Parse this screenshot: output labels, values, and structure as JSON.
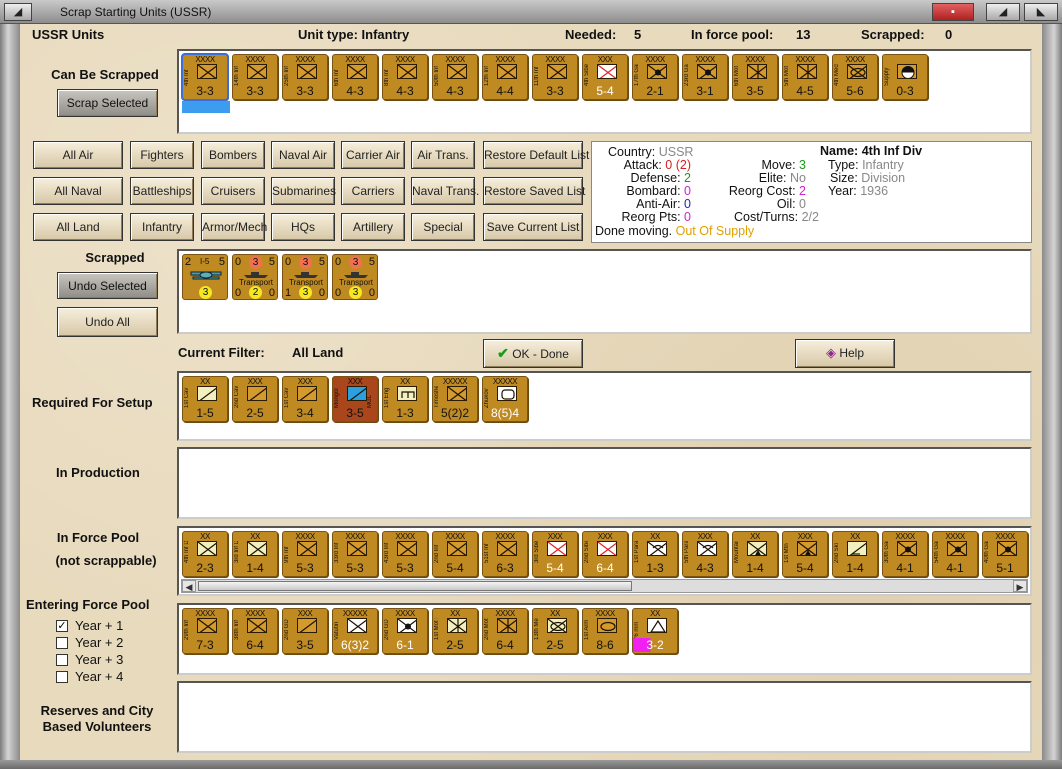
{
  "window": {
    "title": "Scrap Starting Units (USSR)",
    "icon": "window-menu-icon"
  },
  "header": {
    "units_label": "USSR Units",
    "unit_type": "Unit type: Infantry",
    "needed_label": "Needed:",
    "needed": "5",
    "pool_label": "In force pool:",
    "pool": "13",
    "scrapped_label": "Scrapped:",
    "scrapped": "0"
  },
  "labels": {
    "can_be_scrapped": "Can Be Scrapped",
    "scrapped": "Scrapped",
    "current_filter_label": "Current Filter:",
    "current_filter": "All Land",
    "required": "Required For Setup",
    "in_production": "In Production",
    "in_force_pool_1": "In Force Pool",
    "in_force_pool_2": "(not scrappable)",
    "entering": "Entering Force Pool",
    "reserves_1": "Reserves and City",
    "reserves_2": "Based Volunteers"
  },
  "buttons": {
    "scrap_selected": "Scrap Selected",
    "undo_selected": "Undo Selected",
    "undo_all": "Undo All",
    "ok": "OK - Done",
    "help": "Help"
  },
  "filters": [
    [
      "All Air",
      "Fighters",
      "Bombers",
      "Naval Air",
      "Carrier Air",
      "Air Trans.",
      "Restore Default List"
    ],
    [
      "All Naval",
      "Battleships",
      "Cruisers",
      "Submarines",
      "Carriers",
      "Naval Trans.",
      "Restore Saved List"
    ],
    [
      "All Land",
      "Infantry",
      "Armor/Mech",
      "HQs",
      "Artillery",
      "Special",
      "Save Current List"
    ]
  ],
  "info": {
    "country_label": "Country:",
    "country": "USSR",
    "attack_label": "Attack:",
    "attack": "0 (2)",
    "defense_label": "Defense:",
    "defense": "2",
    "bombard_label": "Bombard:",
    "bombard": "0",
    "antiair_label": "Anti-Air:",
    "antiair": "0",
    "reorgpts_label": "Reorg Pts:",
    "reorgpts": "0",
    "done_moving": "Done moving.",
    "supply": "Out Of Supply",
    "move_label": "Move:",
    "move": "3",
    "elite_label": "Elite:",
    "elite": "No",
    "reorgcost_label": "Reorg Cost:",
    "reorgcost": "2",
    "oil_label": "Oil:",
    "oil": "0",
    "costturns_label": "Cost/Turns:",
    "costturns": "2/2",
    "name_label": "Name:",
    "name": "4th Inf Div",
    "type_label": "Type:",
    "type": "Infantry",
    "size_label": "Size:",
    "size": "Division",
    "year_label": "Year:",
    "year": "1936"
  },
  "can_scrap": [
    {
      "size": "XXXX",
      "name": "4th Inf",
      "stats": "3-3",
      "sel": true
    },
    {
      "size": "XXXX",
      "name": "14th Inf",
      "stats": "3-3"
    },
    {
      "size": "XXXX",
      "name": "25th Inf",
      "stats": "3-3"
    },
    {
      "size": "XXXX",
      "name": "6th Inf",
      "stats": "4-3"
    },
    {
      "size": "XXXX",
      "name": "8th Inf",
      "stats": "4-3"
    },
    {
      "size": "XXXX",
      "name": "50th Inf",
      "stats": "4-3"
    },
    {
      "size": "XXXX",
      "name": "12th Inf",
      "stats": "4-4"
    },
    {
      "size": "XXXX",
      "name": "11th Inf",
      "stats": "3-3"
    },
    {
      "size": "XXX",
      "name": "4th Siberian",
      "stats": "5-4",
      "style": "red"
    },
    {
      "size": "XXXX",
      "name": "17th Garr",
      "stats": "2-1",
      "sym": "garr"
    },
    {
      "size": "XXXX",
      "name": "23rd Garr",
      "stats": "3-1",
      "sym": "garr"
    },
    {
      "size": "XXXX",
      "name": "6th Mot",
      "stats": "3-5",
      "sym": "mot"
    },
    {
      "size": "XXXX",
      "name": "5th Mot",
      "stats": "4-5",
      "sym": "mot"
    },
    {
      "size": "XXXX",
      "name": "4th Mech",
      "stats": "5-6",
      "sym": "mech"
    },
    {
      "size": "",
      "name": "Supply",
      "stats": "0-3",
      "sym": "supply"
    }
  ],
  "scrapped_units": [
    {
      "kind": "air",
      "tl": "2",
      "name": "I-5",
      "tr": "5",
      "bl": "",
      "circ": "3"
    },
    {
      "kind": "tr",
      "tl": "0",
      "top": "3",
      "tr": "5",
      "name": "Transport",
      "bl": "0",
      "circ": "2",
      "br": "0"
    },
    {
      "kind": "tr",
      "tl": "0",
      "top": "3",
      "tr": "5",
      "name": "Transport",
      "bl": "1",
      "circ": "3",
      "br": "0"
    },
    {
      "kind": "tr",
      "tl": "0",
      "top": "3",
      "tr": "5",
      "name": "Transport",
      "bl": "0",
      "circ": "3",
      "br": "0"
    }
  ],
  "required": [
    {
      "size": "XX",
      "name": "1st Cav Div",
      "stats": "1-5",
      "sym": "cav",
      "style": "lt"
    },
    {
      "size": "XXX",
      "name": "2nd Cav",
      "stats": "2-5",
      "sym": "cav"
    },
    {
      "size": "XXX",
      "name": "1st Cav",
      "stats": "3-4",
      "sym": "cav"
    },
    {
      "size": "XXX",
      "name": "Mongol",
      "stats": "3-5",
      "sym": "cav",
      "style": "blue",
      "side": "MGL"
    },
    {
      "size": "XX",
      "name": "1st Eng",
      "stats": "1-3",
      "sym": "eng",
      "style": "lt"
    },
    {
      "size": "XXXXX",
      "name": "Timoshenko",
      "stats": "5(2)2",
      "sym": "hq"
    },
    {
      "size": "XXXXX",
      "name": "Zhukov",
      "stats": "8(5)4",
      "sym": "hqw",
      "style": "wh",
      "wtxt": true
    }
  ],
  "force_pool": [
    {
      "size": "XX",
      "name": "4th Inf Div",
      "stats": "2-3",
      "style": "lt"
    },
    {
      "size": "XX",
      "name": "3rd Inf Div",
      "stats": "1-4",
      "style": "lt"
    },
    {
      "size": "XXXX",
      "name": "9th Inf",
      "stats": "5-3"
    },
    {
      "size": "XXXX",
      "name": "33rd Inf",
      "stats": "5-3"
    },
    {
      "size": "XXXX",
      "name": "43rd Inf",
      "stats": "5-3"
    },
    {
      "size": "XXXX",
      "name": "2nd Inf",
      "stats": "5-4"
    },
    {
      "size": "XXXX",
      "name": "51st Inf",
      "stats": "6-3"
    },
    {
      "size": "XXX",
      "name": "3rd Siberian",
      "stats": "5-4",
      "style": "red"
    },
    {
      "size": "XXX",
      "name": "2nd Siberian",
      "stats": "6-4",
      "style": "red"
    },
    {
      "size": "XX",
      "name": "1st Para Div",
      "stats": "1-3",
      "sym": "para",
      "style": "wh"
    },
    {
      "size": "XXX",
      "name": "5th Para",
      "stats": "4-3",
      "sym": "para",
      "style": "wh"
    },
    {
      "size": "XX",
      "name": "Mountain D.",
      "stats": "1-4",
      "sym": "mtn",
      "style": "lt"
    },
    {
      "size": "XXX",
      "name": "1st Mtn",
      "stats": "5-4",
      "sym": "mtn"
    },
    {
      "size": "XX",
      "name": "2nd Ski Div",
      "stats": "1-4",
      "sym": "ski",
      "style": "lt"
    },
    {
      "size": "XXXX",
      "name": "30th Garr",
      "stats": "4-1",
      "sym": "garr"
    },
    {
      "size": "XXXX",
      "name": "54th Garr",
      "stats": "4-1",
      "sym": "garr"
    },
    {
      "size": "XXXX",
      "name": "40th Garr",
      "stats": "5-1",
      "sym": "garr"
    }
  ],
  "entering": [
    {
      "size": "XXXX",
      "name": "29th Inf",
      "stats": "7-3"
    },
    {
      "size": "XXXX",
      "name": "38th Inf",
      "stats": "6-4"
    },
    {
      "size": "XXX",
      "name": "2nd GD Cav",
      "stats": "3-5",
      "sym": "cav"
    },
    {
      "size": "XXXXX",
      "name": "Vatutin",
      "stats": "6(3)2",
      "sym": "hq",
      "style": "wh",
      "wtxt": true
    },
    {
      "size": "XXXX",
      "name": "2nd GD Garr",
      "stats": "6-1",
      "sym": "garr",
      "style": "wh",
      "wtxt": true
    },
    {
      "size": "XX",
      "name": "1st Mot Div",
      "stats": "2-5",
      "sym": "mot",
      "style": "lt"
    },
    {
      "size": "XXXX",
      "name": "2nd Mot",
      "stats": "6-4",
      "sym": "mot"
    },
    {
      "size": "XX",
      "name": "13th Mech",
      "stats": "2-5",
      "sym": "mech",
      "style": "lt"
    },
    {
      "size": "XXXX",
      "name": "1st Arm",
      "stats": "8-6",
      "sym": "arm"
    },
    {
      "size": "XX",
      "name": "76 mm",
      "stats": "3-2",
      "sym": "art",
      "style": "wh",
      "pink": true
    }
  ],
  "years": [
    {
      "label": "Year + 1",
      "checked": "✓"
    },
    {
      "label": "Year + 2",
      "checked": ""
    },
    {
      "label": "Year + 3",
      "checked": ""
    },
    {
      "label": "Year + 4",
      "checked": ""
    }
  ],
  "colors": {
    "counter": "#c08a22",
    "counter_dark": "#7a5312",
    "selection": "#3c9cf0",
    "background": "#e8dabd"
  }
}
